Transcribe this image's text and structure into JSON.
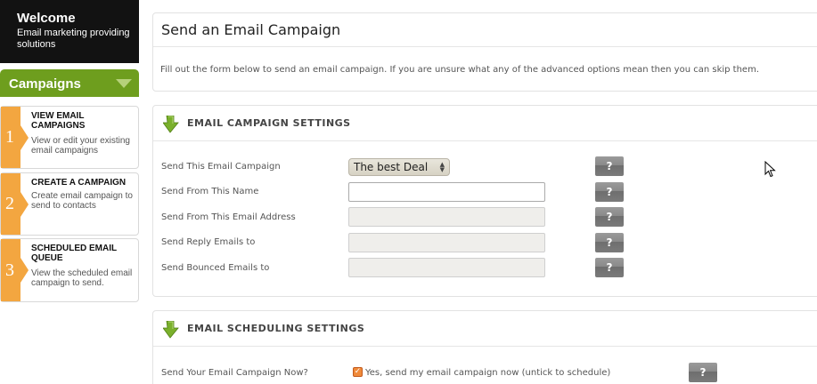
{
  "sidebar": {
    "welcome_title": "Welcome",
    "welcome_subtitle": "Email marketing providing solutions",
    "section_label": "Campaigns",
    "steps": [
      {
        "number": "1",
        "title": "VIEW EMAIL CAMPAIGNS",
        "desc": "View or edit your existing email campaigns"
      },
      {
        "number": "2",
        "title": "CREATE A CAMPAIGN",
        "desc": "Create email campaign to send to contacts"
      },
      {
        "number": "3",
        "title": "SCHEDULED EMAIL QUEUE",
        "desc": "View the scheduled email campaign to send."
      }
    ]
  },
  "main": {
    "title": "Send an Email Campaign",
    "intro": "Fill out the form below to send an email campaign. If you are unsure what any of the advanced options mean then you can skip them.",
    "settings": {
      "heading": "EMAIL CAMPAIGN SETTINGS",
      "fields": [
        {
          "label": "Send This Email Campaign",
          "value": "The best Deal"
        },
        {
          "label": "Send From This Name",
          "value": ""
        },
        {
          "label": "Send From This Email Address",
          "value": ""
        },
        {
          "label": "Send Reply Emails to",
          "value": ""
        },
        {
          "label": "Send Bounced Emails to",
          "value": ""
        }
      ]
    },
    "scheduling": {
      "heading": "EMAIL SCHEDULING SETTINGS",
      "send_now_label": "Send Your Email Campaign Now?",
      "send_now_option": "Yes, send my email campaign now (untick to schedule)",
      "send_now_checked": true
    },
    "help_label": "?"
  },
  "colors": {
    "sidebar_header": "#121212",
    "campaigns_green": "#6e9e1e",
    "step_orange": "#f3a640",
    "section_arrow_green": "#7ab02c",
    "help_button": "#8a8a8a"
  }
}
